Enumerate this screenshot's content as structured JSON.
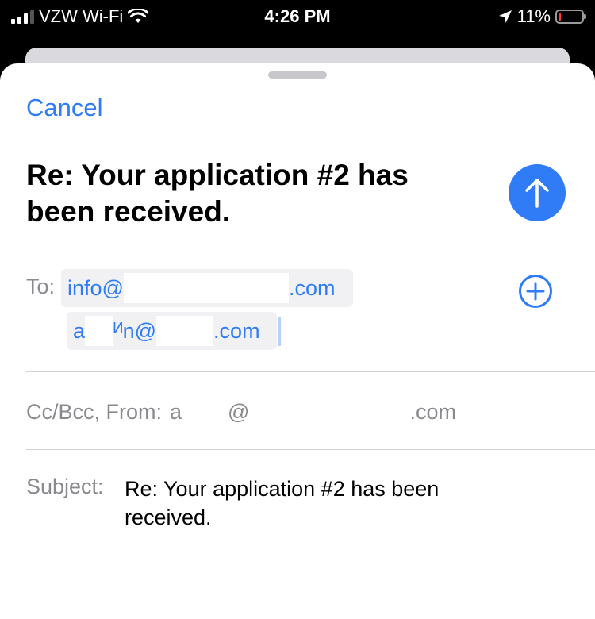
{
  "status_bar": {
    "carrier": "VZW Wi-Fi",
    "time": "4:26 PM",
    "battery_percent_label": "11%",
    "battery_level": 0.11,
    "battery_color": "#ff3b30"
  },
  "compose": {
    "cancel_label": "Cancel",
    "title": "Re: Your application #2 has been received.",
    "send_icon": "arrow-up-icon",
    "accent_color": "#2f7cf6"
  },
  "recipients": {
    "to_label": "To:",
    "items": [
      {
        "prefix": "info@",
        "suffix": ".com"
      },
      {
        "prefix": "a",
        "middle": "ᴻn@",
        "suffix": ".com"
      }
    ],
    "add_icon": "plus-circle-icon"
  },
  "ccbcc": {
    "label": "Cc/Bcc, From:",
    "from_prefix": "a",
    "from_at": "@",
    "from_suffix": ".com"
  },
  "subject": {
    "label": "Subject:",
    "value": "Re: Your application #2 has been received."
  }
}
